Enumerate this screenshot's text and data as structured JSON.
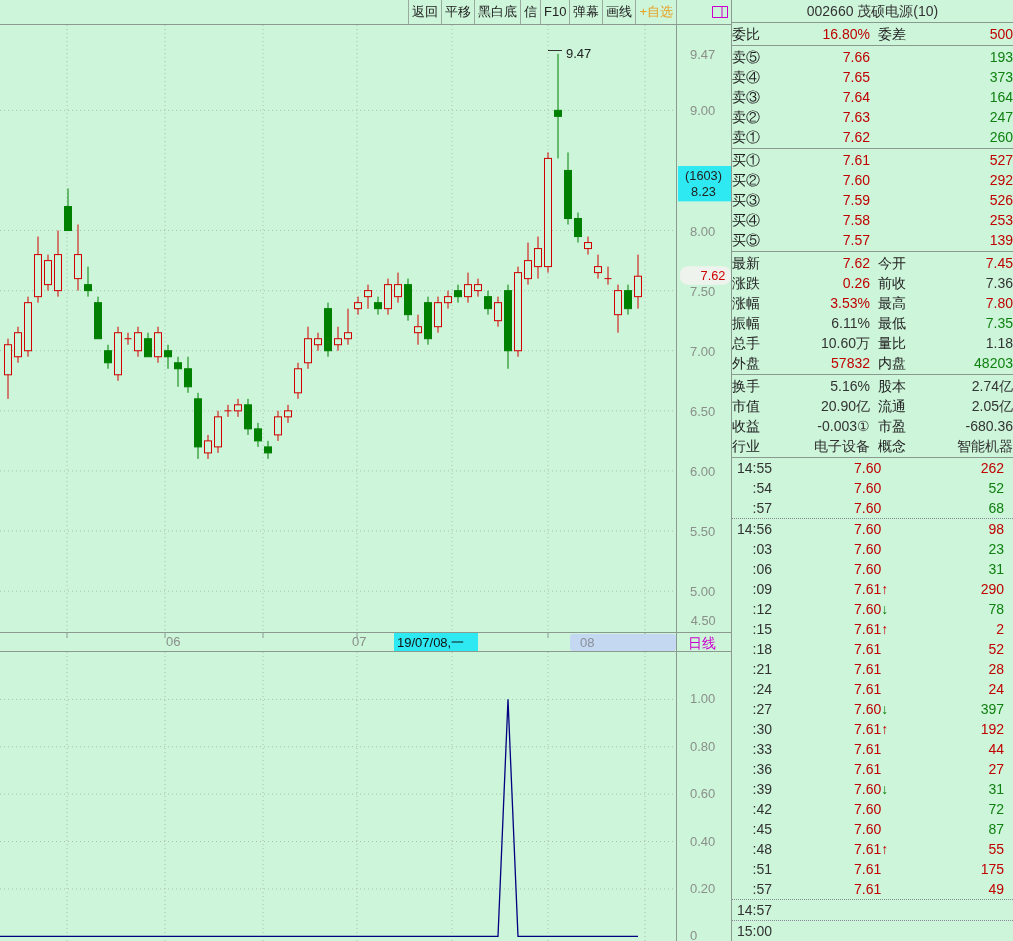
{
  "toolbar": {
    "buttons": [
      {
        "label": "返回",
        "kind": "plain"
      },
      {
        "label": "平移",
        "kind": "plain"
      },
      {
        "label": "黑白底",
        "kind": "plain"
      },
      {
        "label": "信",
        "kind": "plain"
      },
      {
        "label": "F10",
        "kind": "plain"
      },
      {
        "label": "弹幕",
        "kind": "plain"
      },
      {
        "label": "画线",
        "kind": "plain"
      },
      {
        "label": "+自选",
        "kind": "accent"
      }
    ]
  },
  "price_chart": {
    "chart_data": {
      "type": "candlestick",
      "ylim": [
        4.66,
        9.71
      ],
      "yticks": [
        {
          "value": 9.47,
          "label": "9.47"
        },
        {
          "value": 9,
          "label": "9.00"
        },
        {
          "value": 8,
          "label": "8.00"
        },
        {
          "value": 7.5,
          "label": "7.50"
        },
        {
          "value": 7,
          "label": "7.00"
        },
        {
          "value": 6.5,
          "label": "6.50"
        },
        {
          "value": 6,
          "label": "6.00"
        },
        {
          "value": 5.5,
          "label": "5.50"
        },
        {
          "value": 5,
          "label": "5.00"
        }
      ],
      "grid": true,
      "ohlc": [
        [
          6.8,
          7.1,
          6.6,
          7.05
        ],
        [
          6.95,
          7.2,
          6.9,
          7.15
        ],
        [
          7.0,
          7.45,
          6.95,
          7.4
        ],
        [
          7.45,
          7.95,
          7.4,
          7.8
        ],
        [
          7.55,
          7.8,
          7.5,
          7.75
        ],
        [
          7.5,
          8.0,
          7.45,
          7.8
        ],
        [
          8.2,
          8.35,
          8.0,
          8.0
        ],
        [
          7.6,
          8.05,
          7.5,
          7.8
        ],
        [
          7.55,
          7.7,
          7.45,
          7.5
        ],
        [
          7.4,
          7.45,
          7.1,
          7.1
        ],
        [
          7.0,
          7.05,
          6.85,
          6.9
        ],
        [
          6.8,
          7.2,
          6.75,
          7.15
        ],
        [
          7.1,
          7.15,
          7.05,
          7.1
        ],
        [
          7.0,
          7.2,
          6.95,
          7.15
        ],
        [
          7.1,
          7.15,
          6.95,
          6.95
        ],
        [
          6.95,
          7.2,
          6.9,
          7.15
        ],
        [
          7.0,
          7.05,
          6.85,
          6.95
        ],
        [
          6.9,
          6.95,
          6.7,
          6.85
        ],
        [
          6.85,
          6.95,
          6.65,
          6.7
        ],
        [
          6.6,
          6.65,
          6.1,
          6.2
        ],
        [
          6.15,
          6.3,
          6.1,
          6.25
        ],
        [
          6.2,
          6.5,
          6.15,
          6.45
        ],
        [
          6.5,
          6.55,
          6.45,
          6.5
        ],
        [
          6.5,
          6.6,
          6.45,
          6.55
        ],
        [
          6.55,
          6.6,
          6.3,
          6.35
        ],
        [
          6.35,
          6.4,
          6.2,
          6.25
        ],
        [
          6.2,
          6.25,
          6.1,
          6.15
        ],
        [
          6.3,
          6.5,
          6.25,
          6.45
        ],
        [
          6.45,
          6.55,
          6.4,
          6.5
        ],
        [
          6.65,
          6.9,
          6.6,
          6.85
        ],
        [
          6.9,
          7.2,
          6.85,
          7.1
        ],
        [
          7.05,
          7.15,
          7.0,
          7.1
        ],
        [
          7.35,
          7.4,
          6.95,
          7.0
        ],
        [
          7.05,
          7.2,
          7.0,
          7.1
        ],
        [
          7.1,
          7.35,
          7.05,
          7.15
        ],
        [
          7.35,
          7.45,
          7.3,
          7.4
        ],
        [
          7.45,
          7.55,
          7.35,
          7.5
        ],
        [
          7.4,
          7.45,
          7.3,
          7.35
        ],
        [
          7.35,
          7.6,
          7.3,
          7.55
        ],
        [
          7.45,
          7.65,
          7.4,
          7.55
        ],
        [
          7.55,
          7.6,
          7.25,
          7.3
        ],
        [
          7.15,
          7.3,
          7.05,
          7.2
        ],
        [
          7.4,
          7.45,
          7.05,
          7.1
        ],
        [
          7.2,
          7.45,
          7.15,
          7.4
        ],
        [
          7.4,
          7.5,
          7.35,
          7.45
        ],
        [
          7.5,
          7.55,
          7.4,
          7.45
        ],
        [
          7.45,
          7.65,
          7.4,
          7.55
        ],
        [
          7.5,
          7.6,
          7.45,
          7.55
        ],
        [
          7.45,
          7.5,
          7.3,
          7.35
        ],
        [
          7.25,
          7.45,
          7.2,
          7.4
        ],
        [
          7.5,
          7.55,
          6.85,
          7.0
        ],
        [
          7.0,
          7.7,
          6.95,
          7.65
        ],
        [
          7.6,
          7.9,
          7.55,
          7.75
        ],
        [
          7.7,
          7.95,
          7.6,
          7.85
        ],
        [
          7.7,
          8.65,
          7.65,
          8.6
        ],
        [
          9.0,
          9.47,
          8.6,
          8.95
        ],
        [
          8.5,
          8.65,
          8.05,
          8.1
        ],
        [
          8.1,
          8.15,
          7.9,
          7.95
        ],
        [
          7.85,
          7.95,
          7.8,
          7.9
        ],
        [
          7.65,
          7.8,
          7.6,
          7.7
        ],
        [
          7.6,
          7.7,
          7.55,
          7.6
        ],
        [
          7.3,
          7.55,
          7.15,
          7.5
        ],
        [
          7.5,
          7.55,
          7.3,
          7.35
        ],
        [
          7.45,
          7.8,
          7.35,
          7.62
        ]
      ]
    },
    "bottom_label": "4.50",
    "high_label": "9.47",
    "cursor_label": {
      "count": "(1603)",
      "price": "8.23"
    },
    "last_price": "7.62",
    "x_labels": [
      "06",
      "07"
    ],
    "cursor_date": "19/07/08,一",
    "range_label": "08",
    "period": "日线"
  },
  "indicator_chart": {
    "chart_data": {
      "type": "line",
      "grid": true,
      "ylim": [
        -0.02,
        1.2
      ],
      "yticks": [
        {
          "value": 1,
          "label": "1.00"
        },
        {
          "value": 0.8,
          "label": "0.80"
        },
        {
          "value": 0.6,
          "label": "0.60"
        },
        {
          "value": 0.4,
          "label": "0.40"
        },
        {
          "value": 0.2,
          "label": "0.20"
        },
        {
          "value": 0,
          "label": "0"
        }
      ],
      "series": [
        {
          "color": "#000080",
          "values": [
            0,
            0,
            0,
            0,
            0,
            0,
            0,
            0,
            0,
            0,
            0,
            0,
            0,
            0,
            0,
            0,
            0,
            0,
            0,
            0,
            0,
            0,
            0,
            0,
            0,
            0,
            0,
            0,
            0,
            0,
            0,
            0,
            0,
            0,
            0,
            0,
            0,
            0,
            0,
            0,
            0,
            0,
            0,
            0,
            0,
            0,
            0,
            0,
            0,
            0,
            1,
            0,
            0,
            0,
            0,
            0,
            0,
            0,
            0,
            0,
            0,
            0,
            0,
            0
          ]
        }
      ]
    }
  },
  "quote_panel": {
    "title": "002660 茂硕电源(10)",
    "sections": [
      {
        "rows": [
          [
            {
              "text": "委比",
              "kind": "label"
            },
            {
              "text": "16.80%",
              "kind": "up"
            },
            {
              "text": "委差",
              "kind": "label"
            },
            {
              "text": "500",
              "kind": "up"
            }
          ]
        ]
      },
      {
        "rows": [
          [
            {
              "text": "卖⑤",
              "kind": "label"
            },
            {
              "text": "7.66",
              "kind": "up"
            },
            {
              "text": "193",
              "kind": "down"
            }
          ],
          [
            {
              "text": "卖④",
              "kind": "label"
            },
            {
              "text": "7.65",
              "kind": "up"
            },
            {
              "text": "373",
              "kind": "down"
            }
          ],
          [
            {
              "text": "卖③",
              "kind": "label"
            },
            {
              "text": "7.64",
              "kind": "up"
            },
            {
              "text": "164",
              "kind": "down"
            }
          ],
          [
            {
              "text": "卖②",
              "kind": "label"
            },
            {
              "text": "7.63",
              "kind": "up"
            },
            {
              "text": "247",
              "kind": "down"
            }
          ],
          [
            {
              "text": "卖①",
              "kind": "label"
            },
            {
              "text": "7.62",
              "kind": "up"
            },
            {
              "text": "260",
              "kind": "down"
            }
          ]
        ]
      },
      {
        "rows": [
          [
            {
              "text": "买①",
              "kind": "label"
            },
            {
              "text": "7.61",
              "kind": "up"
            },
            {
              "text": "527",
              "kind": "up"
            }
          ],
          [
            {
              "text": "买②",
              "kind": "label"
            },
            {
              "text": "7.60",
              "kind": "up"
            },
            {
              "text": "292",
              "kind": "up"
            }
          ],
          [
            {
              "text": "买③",
              "kind": "label"
            },
            {
              "text": "7.59",
              "kind": "up"
            },
            {
              "text": "526",
              "kind": "up"
            }
          ],
          [
            {
              "text": "买④",
              "kind": "label"
            },
            {
              "text": "7.58",
              "kind": "up"
            },
            {
              "text": "253",
              "kind": "up"
            }
          ],
          [
            {
              "text": "买⑤",
              "kind": "label"
            },
            {
              "text": "7.57",
              "kind": "up"
            },
            {
              "text": "139",
              "kind": "up"
            }
          ]
        ]
      },
      {
        "rows": [
          [
            {
              "text": "最新",
              "kind": "label"
            },
            {
              "text": "7.62",
              "kind": "up"
            },
            {
              "text": "今开",
              "kind": "label"
            },
            {
              "text": "7.45",
              "kind": "up"
            }
          ],
          [
            {
              "text": "涨跌",
              "kind": "label"
            },
            {
              "text": "0.26",
              "kind": "up"
            },
            {
              "text": "前收",
              "kind": "label"
            },
            {
              "text": "7.36",
              "kind": "flat"
            }
          ],
          [
            {
              "text": "涨幅",
              "kind": "label"
            },
            {
              "text": "3.53%",
              "kind": "up"
            },
            {
              "text": "最高",
              "kind": "label"
            },
            {
              "text": "7.80",
              "kind": "up"
            }
          ],
          [
            {
              "text": "振幅",
              "kind": "label"
            },
            {
              "text": "6.11%",
              "kind": "flat"
            },
            {
              "text": "最低",
              "kind": "label"
            },
            {
              "text": "7.35",
              "kind": "down"
            }
          ],
          [
            {
              "text": "总手",
              "kind": "label"
            },
            {
              "text": "10.60万",
              "kind": "flat"
            },
            {
              "text": "量比",
              "kind": "label"
            },
            {
              "text": "1.18",
              "kind": "flat"
            }
          ],
          [
            {
              "text": "外盘",
              "kind": "label"
            },
            {
              "text": "57832",
              "kind": "up"
            },
            {
              "text": "内盘",
              "kind": "label"
            },
            {
              "text": "48203",
              "kind": "down"
            }
          ]
        ]
      },
      {
        "rows": [
          [
            {
              "text": "换手",
              "kind": "label"
            },
            {
              "text": "5.16%",
              "kind": "flat"
            },
            {
              "text": "股本",
              "kind": "label"
            },
            {
              "text": "2.74亿",
              "kind": "flat"
            }
          ],
          [
            {
              "text": "市值",
              "kind": "label"
            },
            {
              "text": "20.90亿",
              "kind": "flat"
            },
            {
              "text": "流通",
              "kind": "label"
            },
            {
              "text": "2.05亿",
              "kind": "flat"
            }
          ],
          [
            {
              "text": "收益",
              "kind": "label"
            },
            {
              "text": "-0.003①",
              "kind": "flat"
            },
            {
              "text": "市盈",
              "kind": "label"
            },
            {
              "text": "-680.36",
              "kind": "flat"
            }
          ],
          [
            {
              "text": "行业",
              "kind": "label"
            },
            {
              "text": "电子设备",
              "kind": "flat"
            },
            {
              "text": "概念",
              "kind": "label"
            },
            {
              "text": "智能机器",
              "kind": "flat"
            }
          ]
        ]
      }
    ]
  },
  "trades": {
    "groups": [
      [
        {
          "time": "14:55",
          "price": "7.60",
          "volume": "262",
          "kind": "buy"
        },
        {
          "time": ":54",
          "price": "7.60",
          "volume": "52",
          "kind": "sell"
        },
        {
          "time": ":57",
          "price": "7.60",
          "volume": "68",
          "kind": "sell"
        }
      ],
      [
        {
          "time": "14:56",
          "price": "7.60",
          "volume": "98",
          "kind": "buy"
        },
        {
          "time": ":03",
          "price": "7.60",
          "volume": "23",
          "kind": "sell"
        },
        {
          "time": ":06",
          "price": "7.60",
          "volume": "31",
          "kind": "sell"
        },
        {
          "time": ":09",
          "price": "7.61",
          "arrow": {
            "text": "↑",
            "kind": "up"
          },
          "volume": "290",
          "kind": "buy"
        },
        {
          "time": ":12",
          "price": "7.60",
          "arrow": {
            "text": "↓",
            "kind": "down"
          },
          "volume": "78",
          "kind": "sell"
        },
        {
          "time": ":15",
          "price": "7.61",
          "arrow": {
            "text": "↑",
            "kind": "up"
          },
          "volume": "2",
          "kind": "buy"
        },
        {
          "time": ":18",
          "price": "7.61",
          "volume": "52",
          "kind": "buy"
        },
        {
          "time": ":21",
          "price": "7.61",
          "volume": "28",
          "kind": "buy"
        },
        {
          "time": ":24",
          "price": "7.61",
          "volume": "24",
          "kind": "buy"
        },
        {
          "time": ":27",
          "price": "7.60",
          "arrow": {
            "text": "↓",
            "kind": "down"
          },
          "volume": "397",
          "kind": "sell"
        },
        {
          "time": ":30",
          "price": "7.61",
          "arrow": {
            "text": "↑",
            "kind": "up"
          },
          "volume": "192",
          "kind": "buy"
        },
        {
          "time": ":33",
          "price": "7.61",
          "volume": "44",
          "kind": "buy"
        },
        {
          "time": ":36",
          "price": "7.61",
          "volume": "27",
          "kind": "buy"
        },
        {
          "time": ":39",
          "price": "7.60",
          "arrow": {
            "text": "↓",
            "kind": "down"
          },
          "volume": "31",
          "kind": "sell"
        },
        {
          "time": ":42",
          "price": "7.60",
          "volume": "72",
          "kind": "sell"
        },
        {
          "time": ":45",
          "price": "7.60",
          "volume": "87",
          "kind": "sell"
        },
        {
          "time": ":48",
          "price": "7.61",
          "arrow": {
            "text": "↑",
            "kind": "up"
          },
          "volume": "55",
          "kind": "buy"
        },
        {
          "time": ":51",
          "price": "7.61",
          "volume": "175",
          "kind": "buy"
        },
        {
          "time": ":57",
          "price": "7.61",
          "volume": "49",
          "kind": "buy"
        }
      ],
      [
        {
          "time": "14:57"
        }
      ],
      [
        {
          "time": "15:00"
        }
      ]
    ]
  }
}
